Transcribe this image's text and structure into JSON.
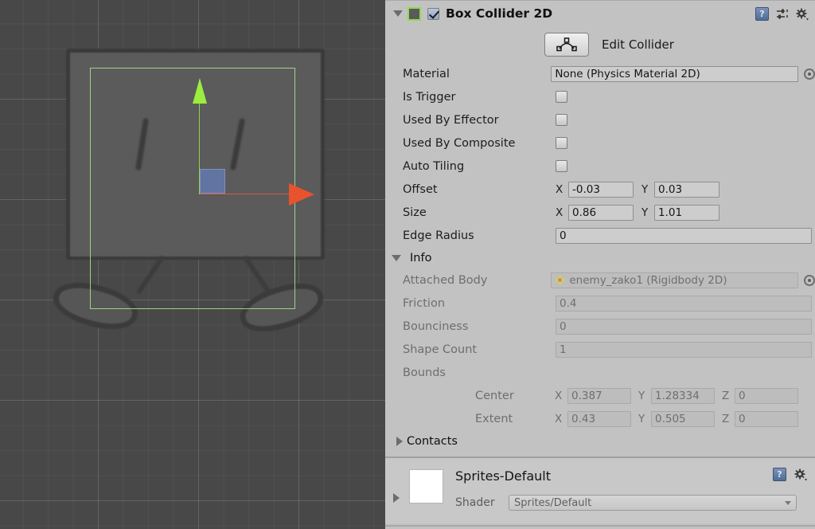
{
  "scene": {
    "name": "scene-view",
    "gizmo": {
      "y_axis_color": "#9bee3e",
      "x_axis_color": "#e8522d",
      "center_handle_color": "#647aba"
    },
    "collider_outline_color": "#9fd18c",
    "background_color": "#484848"
  },
  "inspector": {
    "component": {
      "title": "Box Collider 2D",
      "enabled": true,
      "expanded": true,
      "icon_color": "#5a5a5a",
      "selected_outline_color": "#8ddb4e",
      "header_icons": [
        {
          "name": "help-icon",
          "glyph": "?"
        },
        {
          "name": "preset-icon",
          "glyph": ""
        },
        {
          "name": "settings-gear-icon",
          "glyph": ""
        }
      ]
    },
    "edit_collider": {
      "label": "Edit Collider",
      "icon": "collider-edit-icon"
    },
    "properties": [
      {
        "label": "Material",
        "type": "object",
        "value": "None (Physics Material 2D)",
        "picker": true
      },
      {
        "label": "Is Trigger",
        "type": "checkbox",
        "checked": false
      },
      {
        "label": "Used By Effector",
        "type": "checkbox",
        "checked": false
      },
      {
        "label": "Used By Composite",
        "type": "checkbox",
        "checked": false
      },
      {
        "label": "Auto Tiling",
        "type": "checkbox",
        "checked": false
      }
    ],
    "offset": {
      "label": "Offset",
      "x_axis": "X",
      "x": "-0.03",
      "y_axis": "Y",
      "y": "0.03"
    },
    "size": {
      "label": "Size",
      "x_axis": "X",
      "x": "0.86",
      "y_axis": "Y",
      "y": "1.01"
    },
    "edge_radius": {
      "label": "Edge Radius",
      "value": "0"
    },
    "info": {
      "label": "Info",
      "expanded": true,
      "attached_body": {
        "label": "Attached Body",
        "value": "enemy_zako1 (Rigidbody 2D)",
        "icon": "rigidbody2d-icon",
        "picker": true
      },
      "friction": {
        "label": "Friction",
        "value": "0.4"
      },
      "bounciness": {
        "label": "Bounciness",
        "value": "0"
      },
      "shape_count": {
        "label": "Shape Count",
        "value": "1"
      },
      "bounds": {
        "label": "Bounds",
        "center": {
          "label": "Center",
          "x_axis": "X",
          "x": "0.387",
          "y_axis": "Y",
          "y": "1.28334",
          "z_axis": "Z",
          "z": "0"
        },
        "extent": {
          "label": "Extent",
          "x_axis": "X",
          "x": "0.43",
          "y_axis": "Y",
          "y": "0.505",
          "z_axis": "Z",
          "z": "0"
        }
      },
      "contacts": {
        "label": "Contacts",
        "expanded": false
      }
    }
  },
  "material_footer": {
    "name": "Sprites-Default",
    "swatch_color": "#ffffff",
    "shader_label": "Shader",
    "shader_value": "Sprites/Default",
    "expanded": false,
    "icons": [
      {
        "name": "help-icon",
        "glyph": "?"
      },
      {
        "name": "settings-gear-icon",
        "glyph": ""
      }
    ]
  }
}
